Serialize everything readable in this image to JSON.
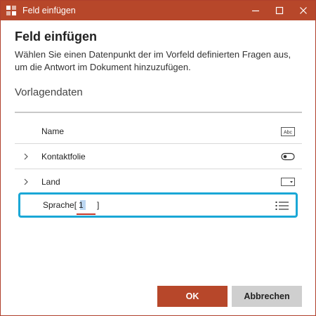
{
  "window": {
    "title": "Feld einfügen",
    "accent_color": "#b7472a",
    "selection_color": "#1aa7d6"
  },
  "dialog": {
    "title": "Feld einfügen",
    "description": "Wählen Sie einen Datenpunkt der im Vorfeld definierten Fragen aus, um die Antwort im Dokument hinzuzufügen."
  },
  "section": {
    "title": "Vorlagendaten"
  },
  "rows": [
    {
      "label": "Name",
      "expandable": false,
      "icon": "text-field-icon",
      "icon_text": "Abc"
    },
    {
      "label": "Kontaktfolie",
      "expandable": true,
      "icon": "toggle-icon"
    },
    {
      "label": "Land",
      "expandable": true,
      "icon": "dropdown-icon"
    }
  ],
  "selected_row": {
    "label": "Sprache[",
    "index_value": "1",
    "close_bracket": "]",
    "icon": "list-icon"
  },
  "buttons": {
    "ok": "OK",
    "cancel": "Abbrechen"
  }
}
